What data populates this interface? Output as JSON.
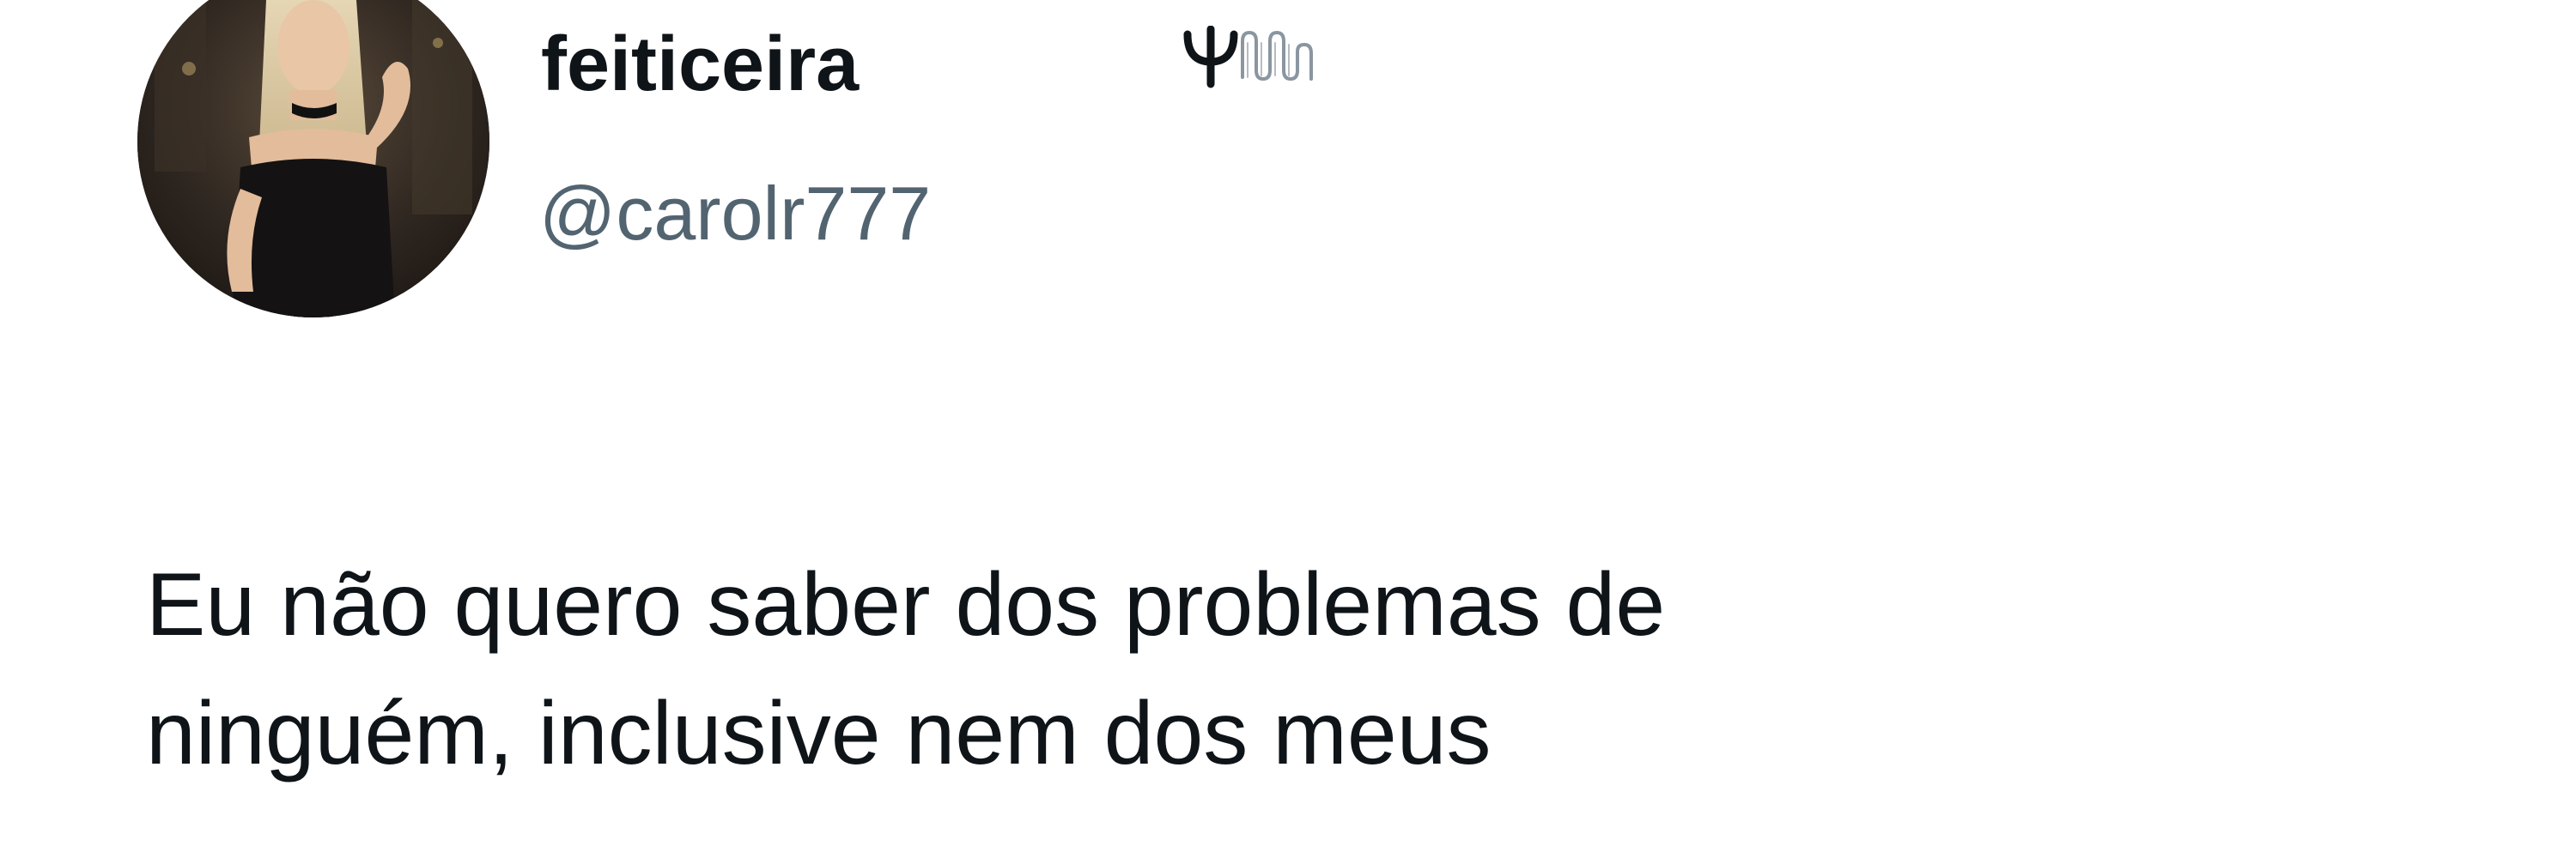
{
  "tweet": {
    "author": {
      "display_name": "feiticeira",
      "name_emoji_icons": [
        "psi-icon",
        "wave-scribble-icon"
      ],
      "handle": "@carolr777"
    },
    "avatar_icon": "profile-photo",
    "text": "Eu não quero saber dos problemas de\nninguém, inclusive nem dos meus"
  },
  "colors": {
    "background": "#ffffff",
    "text_primary": "#0f1419",
    "text_secondary": "#536471"
  }
}
